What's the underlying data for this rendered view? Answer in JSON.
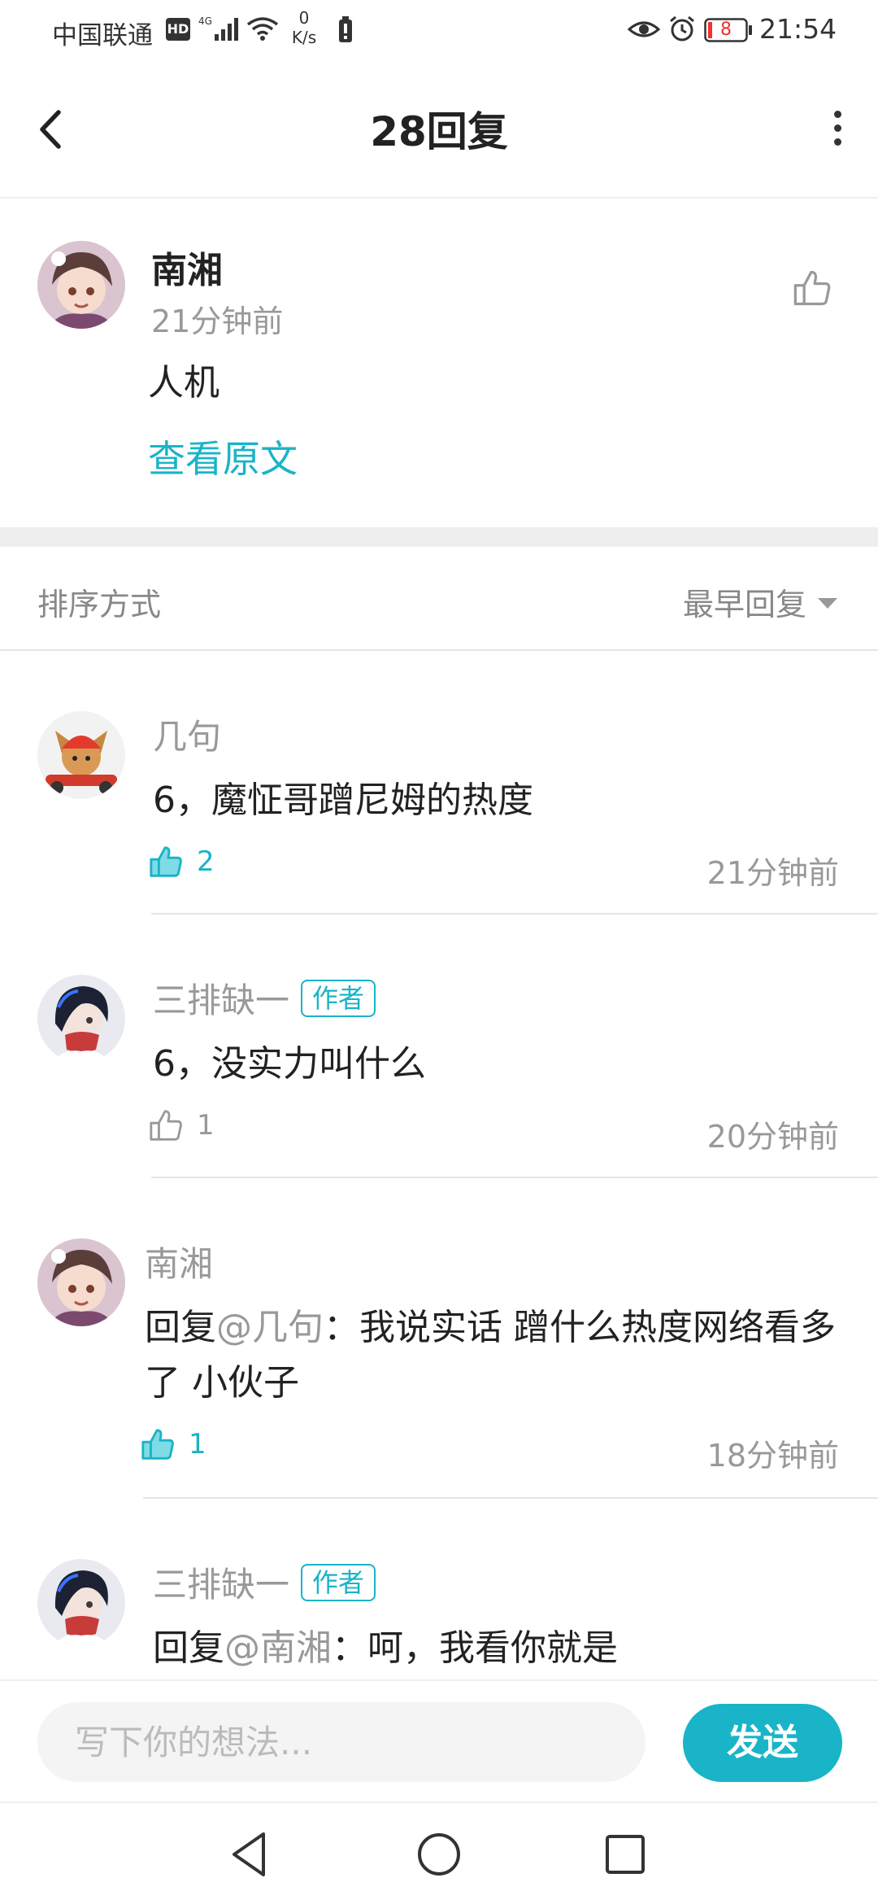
{
  "status_bar": {
    "carrier": "中国联通",
    "hd": "HD",
    "speed_value": "0",
    "speed_unit": "K/s",
    "battery": "8",
    "time": "21:54"
  },
  "header": {
    "title": "28回复"
  },
  "post": {
    "author": "南湘",
    "time": "21分钟前",
    "text": "人机",
    "view_original": "查看原文"
  },
  "sort": {
    "label": "排序方式",
    "selected": "最早回复"
  },
  "comments": [
    {
      "name": "几句",
      "badge": "",
      "reply_prefix": "",
      "mention": "",
      "text": "6，魔怔哥蹭尼姆的热度",
      "likes": "2",
      "liked": true,
      "time": "21分钟前"
    },
    {
      "name": "三排缺一",
      "badge": "作者",
      "reply_prefix": "",
      "mention": "",
      "text": "6，没实力叫什么",
      "likes": "1",
      "liked": false,
      "time": "20分钟前"
    },
    {
      "name": "南湘",
      "badge": "",
      "reply_prefix": "回复",
      "mention": "@几句",
      "text": "：我说实话  蹭什么热度网络看多了 小伙子",
      "likes": "1",
      "liked": true,
      "time": "18分钟前"
    },
    {
      "name": "三排缺一",
      "badge": "作者",
      "reply_prefix": "回复",
      "mention": "@南湘",
      "text": "：呵，我看你就是",
      "likes": "",
      "liked": false,
      "time": ""
    }
  ],
  "input": {
    "placeholder": "写下你的想法...",
    "send_label": "发送"
  },
  "colors": {
    "accent": "#19b4c7",
    "muted": "#999999",
    "text": "#222222",
    "divider": "#eeeeee"
  },
  "icons": {
    "back": "chevron-left-icon",
    "more": "more-vertical-icon",
    "like": "thumbs-up-icon",
    "sort": "caret-down-icon"
  }
}
